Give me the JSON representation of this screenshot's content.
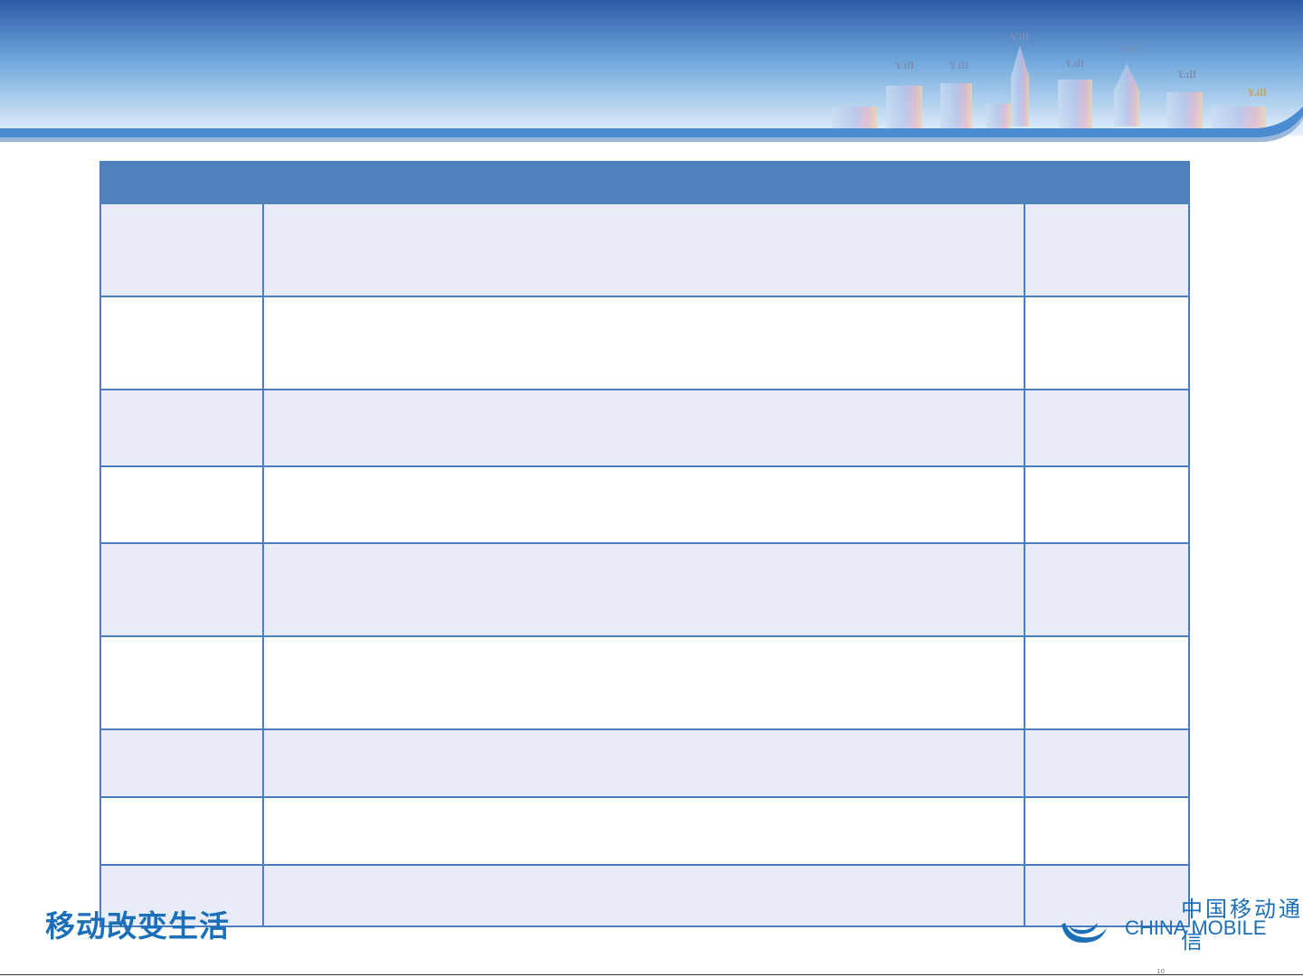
{
  "header": {
    "signal_label": "Y.ıll",
    "accent_color": "#2e5aa8",
    "stripe_color": "#4a8ccf"
  },
  "table": {
    "header_color": "#4f81bd",
    "band_color": "#e8ecf6",
    "columns": [
      "",
      "",
      ""
    ],
    "rows": [
      [
        "",
        "",
        ""
      ],
      [
        "",
        "",
        ""
      ],
      [
        "",
        "",
        ""
      ],
      [
        "",
        "",
        ""
      ],
      [
        "",
        "",
        ""
      ],
      [
        "",
        "",
        ""
      ],
      [
        "",
        "",
        ""
      ],
      [
        "",
        "",
        ""
      ],
      [
        "",
        "",
        ""
      ]
    ]
  },
  "footer": {
    "slogan": "移动改变生活",
    "brand_cn": "中国移动通信",
    "brand_en": "CHINA MOBILE",
    "brand_color": "#1b6fb8",
    "page_mark": "10"
  }
}
